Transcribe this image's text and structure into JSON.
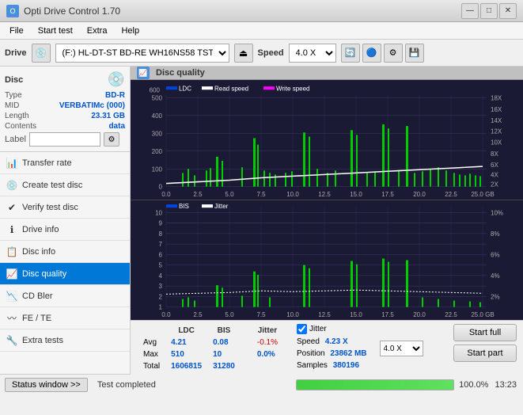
{
  "titlebar": {
    "title": "Opti Drive Control 1.70",
    "minimize": "—",
    "maximize": "□",
    "close": "✕"
  },
  "menubar": {
    "items": [
      "File",
      "Start test",
      "Extra",
      "Help"
    ]
  },
  "drivebar": {
    "label": "Drive",
    "drive_value": "(F:)  HL-DT-ST BD-RE  WH16NS58 TST4",
    "speed_label": "Speed",
    "speed_value": "4.0 X"
  },
  "disc": {
    "title": "Disc",
    "type_label": "Type",
    "type_value": "BD-R",
    "mid_label": "MID",
    "mid_value": "VERBATIMc (000)",
    "length_label": "Length",
    "length_value": "23.31 GB",
    "contents_label": "Contents",
    "contents_value": "data",
    "label_label": "Label"
  },
  "nav": {
    "items": [
      {
        "id": "transfer-rate",
        "label": "Transfer rate",
        "icon": "📊"
      },
      {
        "id": "create-test-disc",
        "label": "Create test disc",
        "icon": "💿"
      },
      {
        "id": "verify-test-disc",
        "label": "Verify test disc",
        "icon": "✔"
      },
      {
        "id": "drive-info",
        "label": "Drive info",
        "icon": "ℹ"
      },
      {
        "id": "disc-info",
        "label": "Disc info",
        "icon": "📋"
      },
      {
        "id": "disc-quality",
        "label": "Disc quality",
        "icon": "📈",
        "active": true
      },
      {
        "id": "cd-bler",
        "label": "CD Bler",
        "icon": "📉"
      },
      {
        "id": "fe-te",
        "label": "FE / TE",
        "icon": "〰"
      },
      {
        "id": "extra-tests",
        "label": "Extra tests",
        "icon": "🔧"
      }
    ]
  },
  "disc_quality": {
    "title": "Disc quality",
    "legend": {
      "ldc_label": "LDC",
      "read_speed_label": "Read speed",
      "write_speed_label": "Write speed",
      "bis_label": "BIS",
      "jitter_label": "Jitter"
    }
  },
  "chart_top": {
    "y_left_max": 600,
    "y_left_ticks": [
      600,
      500,
      400,
      300,
      200,
      100
    ],
    "y_right_labels": [
      "18X",
      "16X",
      "14X",
      "12X",
      "10X",
      "8X",
      "6X",
      "4X",
      "2X"
    ],
    "x_labels": [
      "0.0",
      "2.5",
      "5.0",
      "7.5",
      "10.0",
      "12.5",
      "15.0",
      "17.5",
      "20.0",
      "22.5",
      "25.0 GB"
    ]
  },
  "chart_bottom": {
    "y_left_max": 10,
    "y_left_ticks": [
      10,
      9,
      8,
      7,
      6,
      5,
      4,
      3,
      2,
      1
    ],
    "y_right_labels": [
      "10%",
      "8%",
      "6%",
      "4%",
      "2%"
    ],
    "x_labels": [
      "0.0",
      "2.5",
      "5.0",
      "7.5",
      "10.0",
      "12.5",
      "15.0",
      "17.5",
      "20.0",
      "22.5",
      "25.0 GB"
    ]
  },
  "stats": {
    "ldc_header": "LDC",
    "bis_header": "BIS",
    "jitter_header": "Jitter",
    "speed_header": "Speed",
    "avg_label": "Avg",
    "max_label": "Max",
    "total_label": "Total",
    "ldc_avg": "4.21",
    "ldc_max": "510",
    "ldc_total": "1606815",
    "bis_avg": "0.08",
    "bis_max": "10",
    "bis_total": "31280",
    "jitter_avg": "-0.1%",
    "jitter_max": "0.0%",
    "jitter_total": "",
    "speed_value": "4.23 X",
    "speed_dropdown": "4.0 X",
    "position_label": "Position",
    "position_value": "23862 MB",
    "samples_label": "Samples",
    "samples_value": "380196"
  },
  "buttons": {
    "start_full": "Start full",
    "start_part": "Start part"
  },
  "statusbar": {
    "window_btn": "Status window >>",
    "status_text": "Test completed",
    "progress_pct": "100.0%",
    "time": "13:23"
  }
}
